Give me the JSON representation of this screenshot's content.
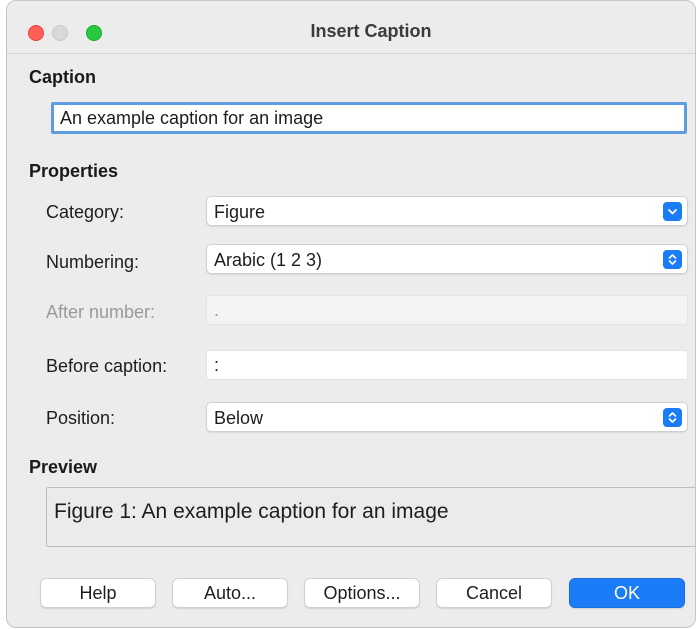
{
  "window": {
    "title": "Insert Caption"
  },
  "caption": {
    "heading": "Caption",
    "value": "An example caption for an image"
  },
  "properties": {
    "heading": "Properties",
    "category": {
      "label": "Category:",
      "value": "Figure"
    },
    "numbering": {
      "label": "Numbering:",
      "value": "Arabic (1 2 3)"
    },
    "after_number": {
      "label": "After number:",
      "value": "."
    },
    "before_caption": {
      "label": "Before caption:",
      "value": ":"
    },
    "position": {
      "label": "Position:",
      "value": "Below"
    }
  },
  "preview": {
    "heading": "Preview",
    "text": "Figure 1: An example caption for an image"
  },
  "buttons": {
    "help": "Help",
    "auto": "Auto...",
    "options": "Options...",
    "cancel": "Cancel",
    "ok": "OK"
  },
  "colors": {
    "accent": "#1a7cf6",
    "close": "#fe5f57",
    "zoom": "#28c840",
    "focus_ring": "#5e9de0"
  }
}
